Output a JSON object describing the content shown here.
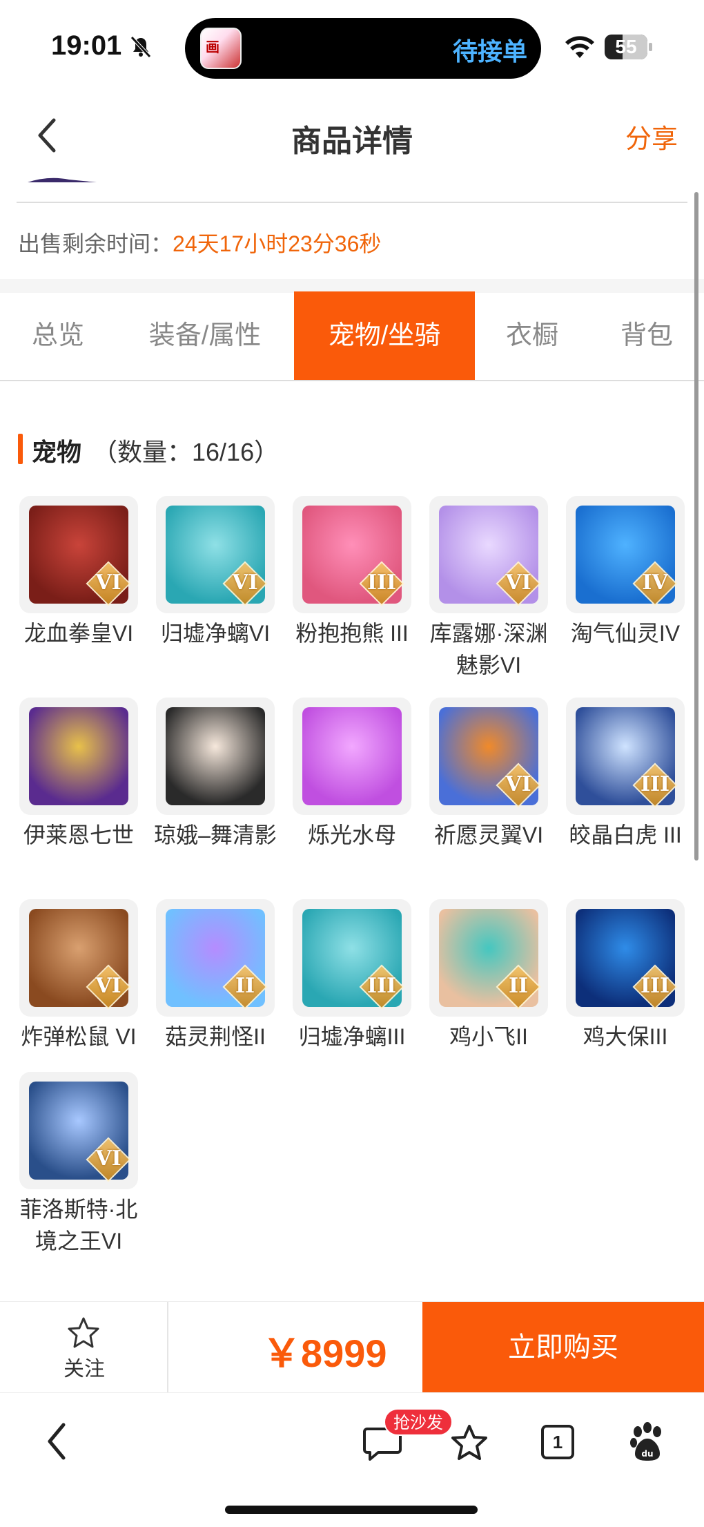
{
  "status_bar": {
    "time": "19:01",
    "island_text": "待接单",
    "battery": "55"
  },
  "header": {
    "title": "商品详情",
    "share": "分享"
  },
  "sale": {
    "label": "出售剩余时间：",
    "value": "24天17小时23分36秒"
  },
  "tabs": [
    {
      "label": "总览"
    },
    {
      "label": "装备/属性"
    },
    {
      "label": "宠物/坐骑",
      "active": true
    },
    {
      "label": "衣橱"
    },
    {
      "label": "背包"
    }
  ],
  "section": {
    "title": "宠物",
    "count": "（数量：16/16）"
  },
  "pets": [
    {
      "name": "龙血拳皇VI",
      "badge": "VI",
      "colors": [
        "#c9443a",
        "#7a1e18"
      ]
    },
    {
      "name": "归墟净螭VI",
      "badge": "VI",
      "colors": [
        "#8fe0e6",
        "#2aa7b3"
      ]
    },
    {
      "name": "粉抱抱熊 III",
      "badge": "III",
      "colors": [
        "#ff8fb8",
        "#e0577e"
      ]
    },
    {
      "name": "库露娜·深渊魅影VI",
      "badge": "VI",
      "colors": [
        "#e9d9ff",
        "#b390e8"
      ]
    },
    {
      "name": "淘气仙灵IV",
      "badge": "IV",
      "colors": [
        "#4fb2ff",
        "#1a6fd0"
      ]
    },
    {
      "name": "伊莱恩七世",
      "badge": "",
      "colors": [
        "#e8c14a",
        "#5a2b8f"
      ]
    },
    {
      "name": "琼娥–舞清影",
      "badge": "",
      "colors": [
        "#f6e8dc",
        "#2a2a2a"
      ]
    },
    {
      "name": "烁光水母",
      "badge": "",
      "colors": [
        "#f2a8ff",
        "#c04fe0"
      ]
    },
    {
      "name": "祈愿灵翼VI",
      "badge": "VI",
      "colors": [
        "#f08a2a",
        "#4a6fd8"
      ]
    },
    {
      "name": "皎晶白虎 III",
      "badge": "III",
      "colors": [
        "#cfe3ff",
        "#2f4f9a"
      ]
    },
    {
      "name": "炸弹松鼠 VI",
      "badge": "VI",
      "colors": [
        "#d9a070",
        "#8a4a20"
      ]
    },
    {
      "name": "菇灵荆怪II",
      "badge": "II",
      "colors": [
        "#b58cff",
        "#70c0ff"
      ]
    },
    {
      "name": "归墟净螭III",
      "badge": "III",
      "colors": [
        "#8fe0e6",
        "#2aa7b3"
      ]
    },
    {
      "name": "鸡小飞II",
      "badge": "II",
      "colors": [
        "#45c7c0",
        "#e9c0a0"
      ]
    },
    {
      "name": "鸡大保III",
      "badge": "III",
      "colors": [
        "#2f8ce8",
        "#0d2f7a"
      ]
    },
    {
      "name": "菲洛斯特·北境之王VI",
      "badge": "VI",
      "colors": [
        "#a8c8ff",
        "#2a4f8a"
      ]
    }
  ],
  "action_bar": {
    "follow": "关注",
    "price": "￥8999",
    "buy": "立即购买"
  },
  "browser_bar": {
    "chat_badge": "抢沙发",
    "tab_count": "1"
  },
  "colors": {
    "accent": "#fa5a0a",
    "accent_text": "#f0650a"
  }
}
